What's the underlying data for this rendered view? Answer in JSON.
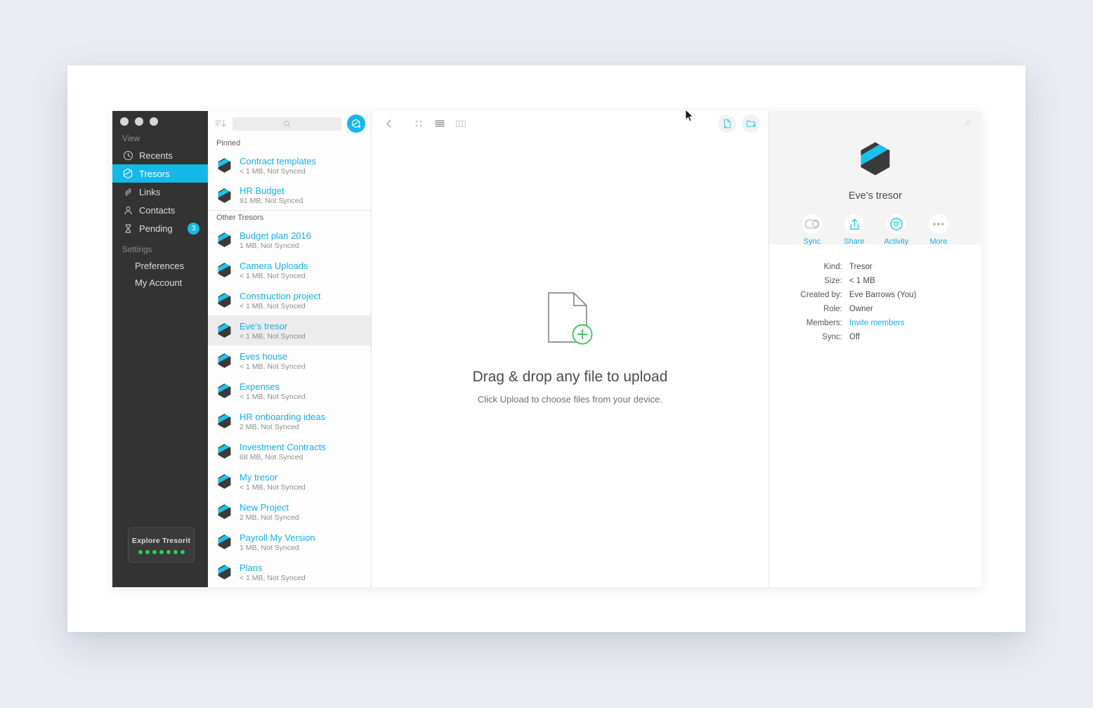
{
  "app": {
    "title": "Tresorit",
    "window_controls": [
      "close",
      "minimize",
      "maximize"
    ]
  },
  "colors": {
    "accent": "#15b9e8",
    "link": "#16aee6",
    "sidebar_bg": "#333333",
    "selection_bg": "#ececec",
    "promo_dot": "#2ecc55",
    "plus_green": "#3fc55a"
  },
  "sidebar": {
    "groups": [
      {
        "label": "View",
        "items": [
          {
            "label": "Recents",
            "icon": "clock-icon",
            "active": false,
            "badge": ""
          },
          {
            "label": "Tresors",
            "icon": "tresor-icon",
            "active": true,
            "badge": ""
          },
          {
            "label": "Links",
            "icon": "link-icon",
            "active": false,
            "badge": ""
          },
          {
            "label": "Contacts",
            "icon": "person-icon",
            "active": false,
            "badge": ""
          },
          {
            "label": "Pending",
            "icon": "hourglass-icon",
            "active": false,
            "badge": "3"
          }
        ]
      },
      {
        "label": "Settings",
        "items": [
          {
            "label": "Preferences",
            "icon": "",
            "active": false,
            "badge": ""
          },
          {
            "label": "My Account",
            "icon": "",
            "active": false,
            "badge": ""
          }
        ]
      }
    ],
    "promo": {
      "label": "Explore Tresorit",
      "dots": 7
    }
  },
  "list_pane": {
    "sort_icon": "sort-descending-icon",
    "search": {
      "value": "",
      "placeholder": "",
      "icon": "search-icon"
    },
    "add_button": {
      "icon": "add-tresor-icon",
      "label": ""
    },
    "groups": [
      {
        "label": "Pinned",
        "items": [
          {
            "name": "Contract templates",
            "meta": "< 1 MB, Not Synced",
            "selected": false
          },
          {
            "name": "HR Budget",
            "meta": "91 MB, Not Synced",
            "selected": false
          }
        ]
      },
      {
        "label": "Other Tresors",
        "items": [
          {
            "name": "Budget plan 2016",
            "meta": "1 MB, Not Synced",
            "selected": false
          },
          {
            "name": "Camera Uploads",
            "meta": "< 1 MB, Not Synced",
            "selected": false
          },
          {
            "name": "Construction project",
            "meta": "< 1 MB, Not Synced",
            "selected": false
          },
          {
            "name": "Eve's tresor",
            "meta": "< 1 MB, Not Synced",
            "selected": true
          },
          {
            "name": "Eves house",
            "meta": "< 1 MB, Not Synced",
            "selected": false
          },
          {
            "name": "Expenses",
            "meta": "< 1 MB, Not Synced",
            "selected": false
          },
          {
            "name": "HR onboarding ideas",
            "meta": "2 MB, Not Synced",
            "selected": false
          },
          {
            "name": "Investment Contracts",
            "meta": "68 MB, Not Synced",
            "selected": false
          },
          {
            "name": "My tresor",
            "meta": "< 1 MB, Not Synced",
            "selected": false
          },
          {
            "name": "New Project",
            "meta": "2 MB, Not Synced",
            "selected": false
          },
          {
            "name": "Payroll My Version",
            "meta": "1 MB, Not Synced",
            "selected": false
          },
          {
            "name": "Plans",
            "meta": "< 1 MB, Not Synced",
            "selected": false
          }
        ]
      }
    ]
  },
  "main": {
    "toolbar": {
      "back_icon": "chevron-left-icon",
      "views": [
        {
          "icon": "grid-view-icon",
          "active": false
        },
        {
          "icon": "list-view-icon",
          "active": true
        },
        {
          "icon": "column-view-icon",
          "active": false
        }
      ],
      "right_buttons": [
        {
          "icon": "upload-file-icon"
        },
        {
          "icon": "new-folder-icon"
        }
      ]
    },
    "dropzone": {
      "icon": "file-plus-icon",
      "title": "Drag & drop any file to upload",
      "subtitle": "Click Upload to choose files from your device."
    }
  },
  "detail": {
    "pin_icon": "pin-icon",
    "hex_icon": "tresor-hex-icon",
    "name": "Eve's tresor",
    "actions": [
      {
        "label": "Sync",
        "icon": "toggle-off-icon"
      },
      {
        "label": "Share",
        "icon": "share-icon"
      },
      {
        "label": "Activity",
        "icon": "activity-icon"
      },
      {
        "label": "More",
        "icon": "ellipsis-icon"
      }
    ],
    "properties": [
      {
        "key": "Kind:",
        "value": "Tresor",
        "link": false
      },
      {
        "key": "Size:",
        "value": "< 1 MB",
        "link": false
      },
      {
        "key": "Created by:",
        "value": "Eve Barrows (You)",
        "link": false
      },
      {
        "key": "Role:",
        "value": "Owner",
        "link": false
      },
      {
        "key": "Members:",
        "value": "Invite members",
        "link": true
      },
      {
        "key": "Sync:",
        "value": "Off",
        "link": false
      }
    ]
  }
}
